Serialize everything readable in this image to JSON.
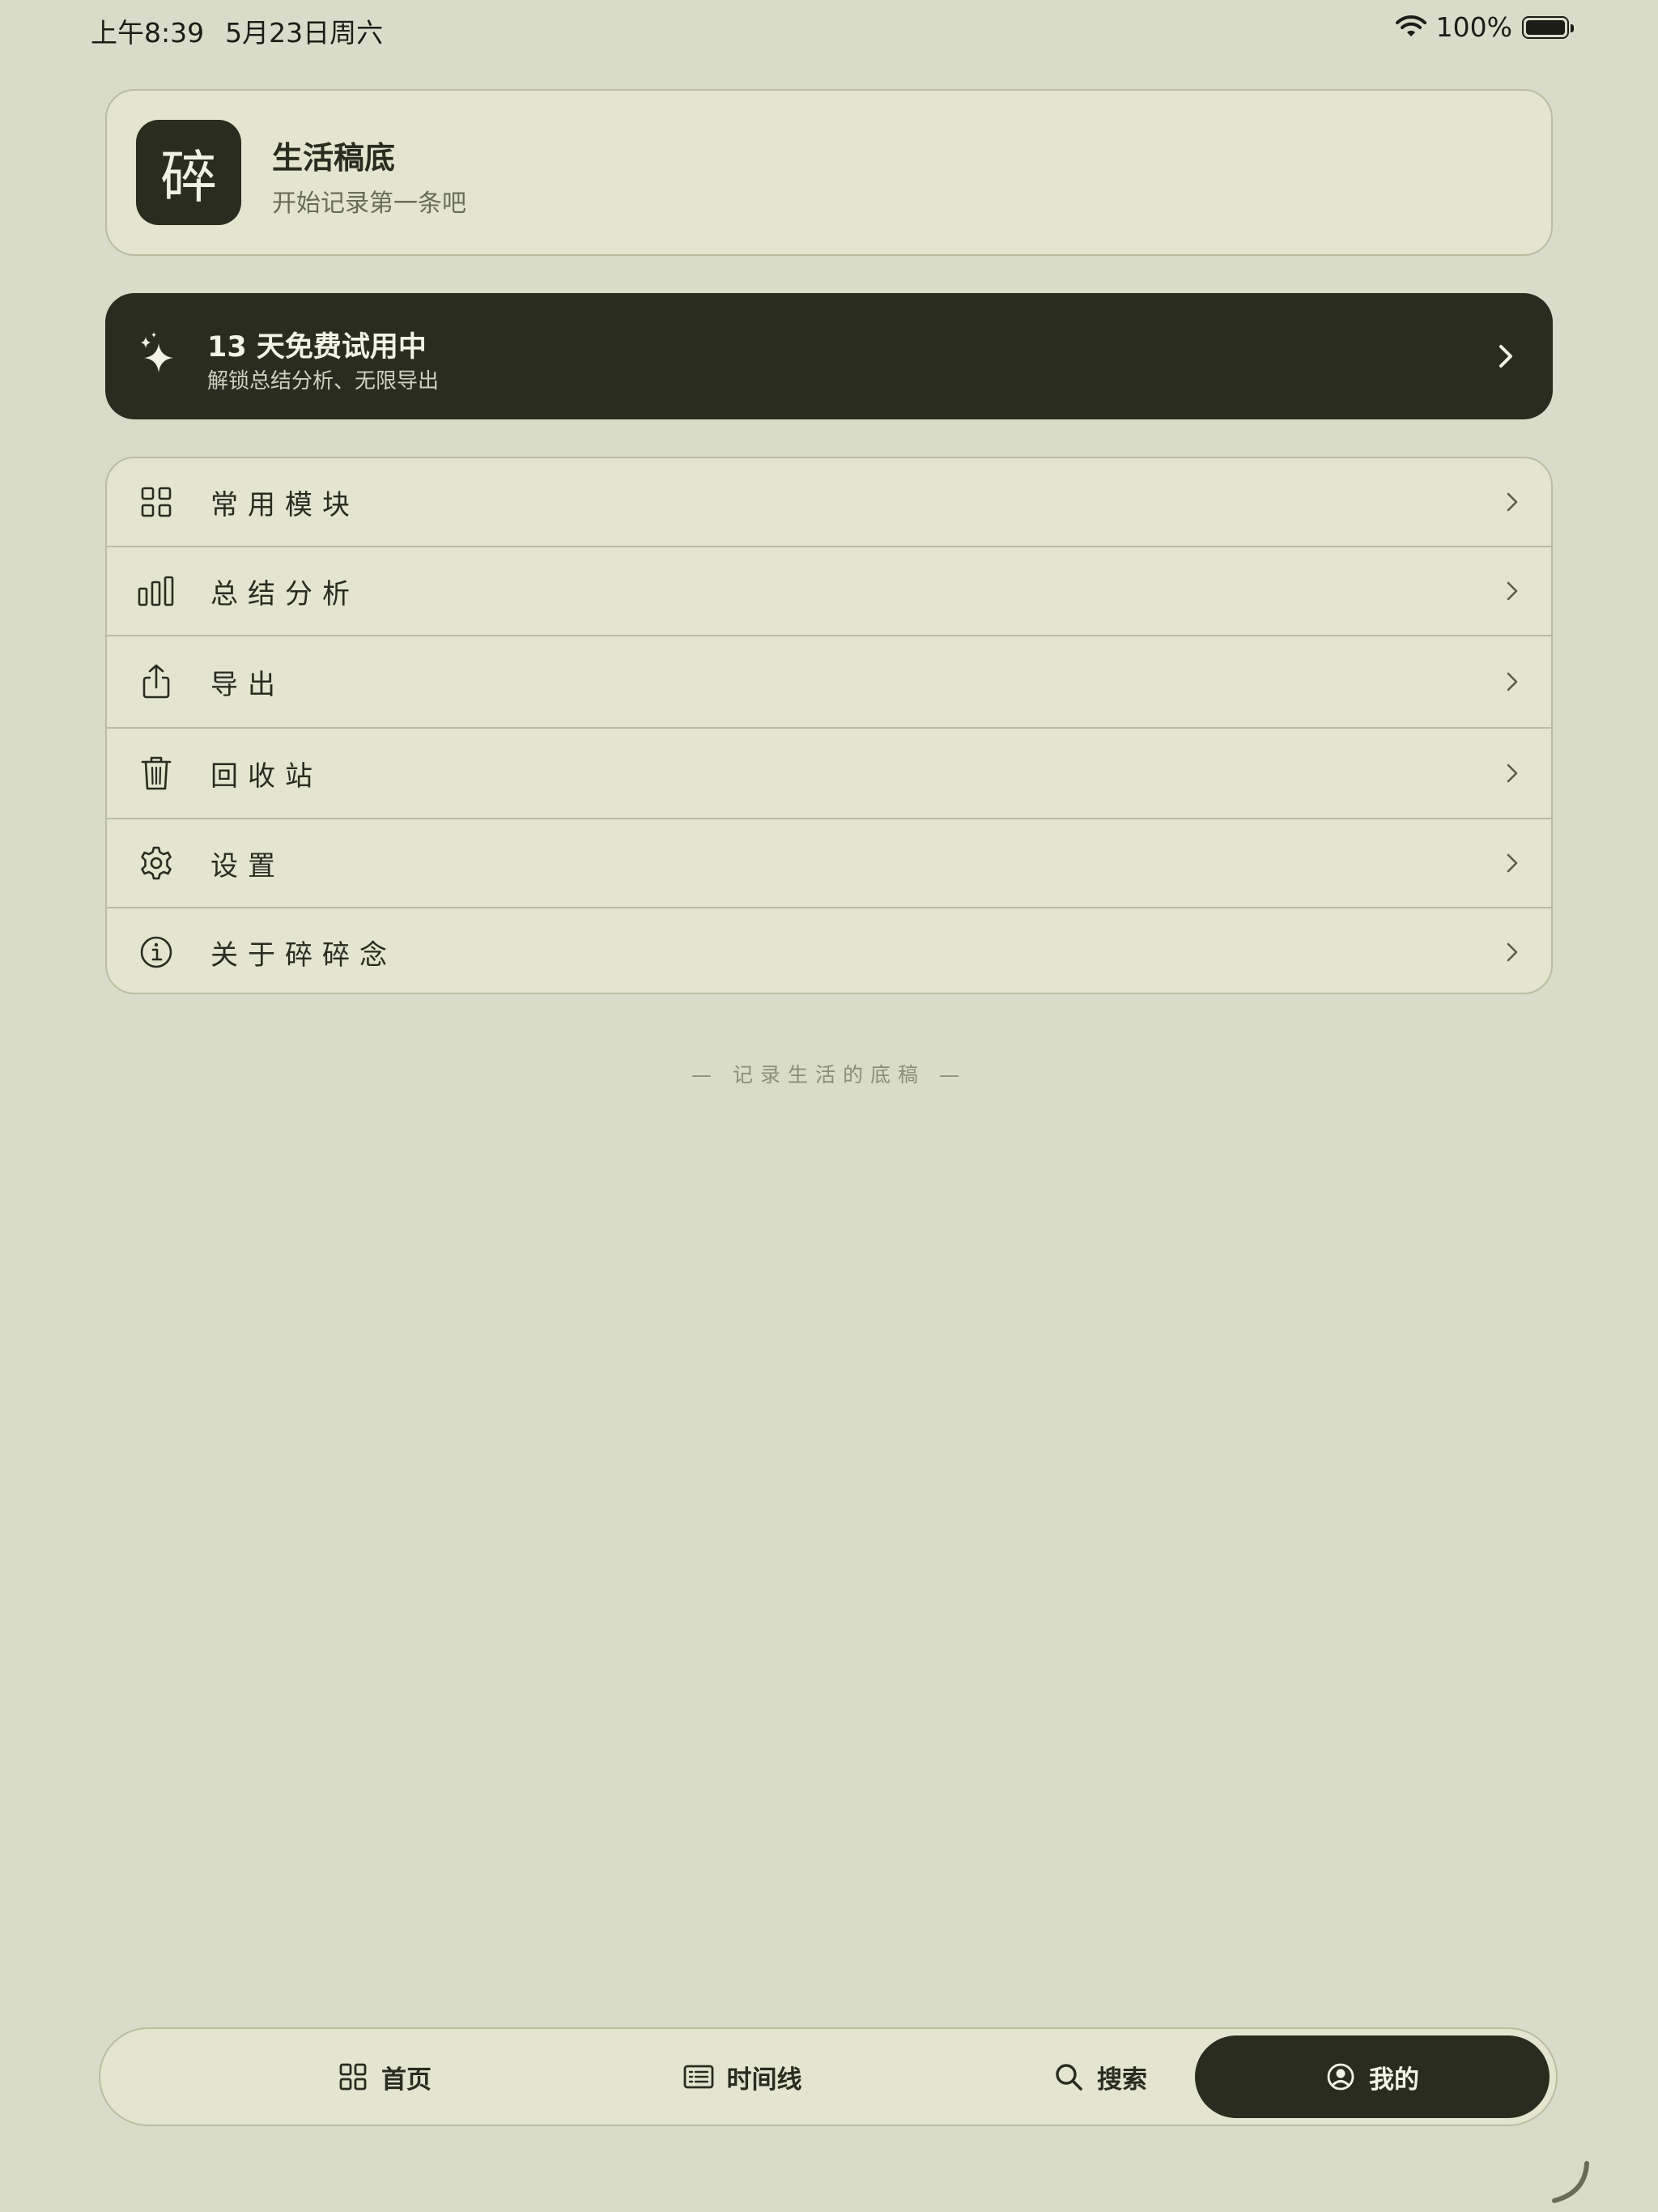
{
  "status_bar": {
    "time": "上午8:39",
    "date": "5月23日周六",
    "battery": "100%"
  },
  "profile": {
    "icon_char": "碎",
    "title": "生活稿底",
    "subtitle": "开始记录第一条吧"
  },
  "trial": {
    "title": "13 天免费试用中",
    "subtitle": "解锁总结分析、无限导出"
  },
  "menu": {
    "items": [
      {
        "label": "常用模块",
        "icon": "grid-icon"
      },
      {
        "label": "总结分析",
        "icon": "bar-chart-icon"
      },
      {
        "label": "导出",
        "icon": "share-icon"
      },
      {
        "label": "回收站",
        "icon": "trash-icon"
      },
      {
        "label": "设置",
        "icon": "gear-icon"
      },
      {
        "label": "关于碎碎念",
        "icon": "info-icon"
      }
    ]
  },
  "tagline": "— 记录生活的底稿 —",
  "tabs": [
    {
      "label": "首页",
      "icon": "grid-icon"
    },
    {
      "label": "时间线",
      "icon": "timeline-icon"
    },
    {
      "label": "搜索",
      "icon": "search-icon"
    },
    {
      "label": "我的",
      "icon": "user-icon"
    }
  ],
  "colors": {
    "background": "#d9dcc8",
    "card": "#e3e5ce",
    "dark": "#2a2c20"
  }
}
